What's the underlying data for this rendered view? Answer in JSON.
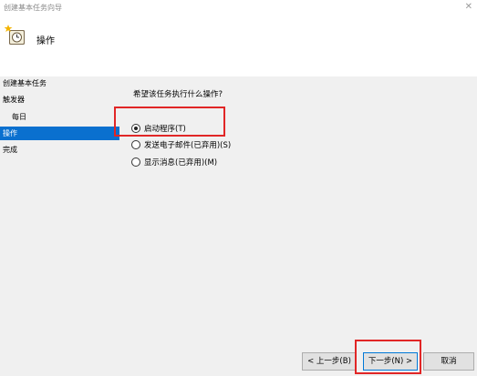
{
  "window": {
    "title": "创建基本任务向导",
    "close_glyph": "✕"
  },
  "header": {
    "title": "操作",
    "icon": "task-scheduler-icon"
  },
  "sidebar": {
    "items": [
      {
        "label": "创建基本任务"
      },
      {
        "label": "触发器"
      },
      {
        "label": "每日"
      },
      {
        "label": "操作"
      },
      {
        "label": "完成"
      }
    ],
    "active_index": 3
  },
  "main": {
    "question": "希望该任务执行什么操作?",
    "options": [
      {
        "label": "启动程序(T)",
        "selected": true
      },
      {
        "label": "发送电子邮件(已弃用)(S)",
        "selected": false
      },
      {
        "label": "显示消息(已弃用)(M)",
        "selected": false
      }
    ]
  },
  "buttons": {
    "back": "< 上一步(B)",
    "next": "下一步(N) >",
    "cancel": "取消"
  },
  "colors": {
    "accent": "#0a70cf",
    "highlight": "#e12626"
  }
}
